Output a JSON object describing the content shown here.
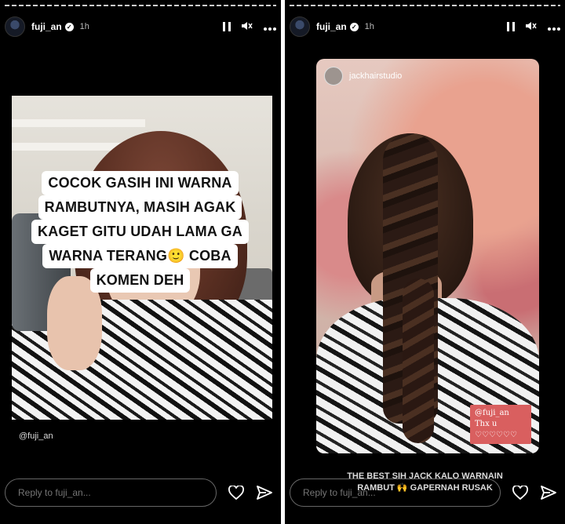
{
  "colors": {
    "background": "#000000",
    "text": "#ffffff",
    "sticker": "#d95f5f"
  },
  "left_story": {
    "username": "fuji_an",
    "time": "1h",
    "caption_lines": [
      "COCOK GASIH INI WARNA",
      "RAMBUTNYA, MASIH AGAK",
      "KAGET GITU UDAH LAMA GA",
      "WARNA TERANG🙂 COBA",
      "KOMEN DEH"
    ],
    "mention": "@fuji_an",
    "reply_placeholder": "Reply to fuji_an..."
  },
  "right_story": {
    "username": "fuji_an",
    "time": "1h",
    "reposted_from": "jackhairstudio",
    "sticker_lines": [
      "@fuji_an",
      "Thx u",
      "♡♡♡♡♡♡"
    ],
    "caption_lines": [
      "THE BEST SIH JACK KALO WARNAIN",
      "RAMBUT 🙌 GAPERNAH RUSAK"
    ],
    "reply_placeholder": "Reply to fuji_an..."
  },
  "icons": [
    "verified-icon",
    "pause-icon",
    "mute-icon",
    "more-icon",
    "heart-icon",
    "send-icon"
  ]
}
